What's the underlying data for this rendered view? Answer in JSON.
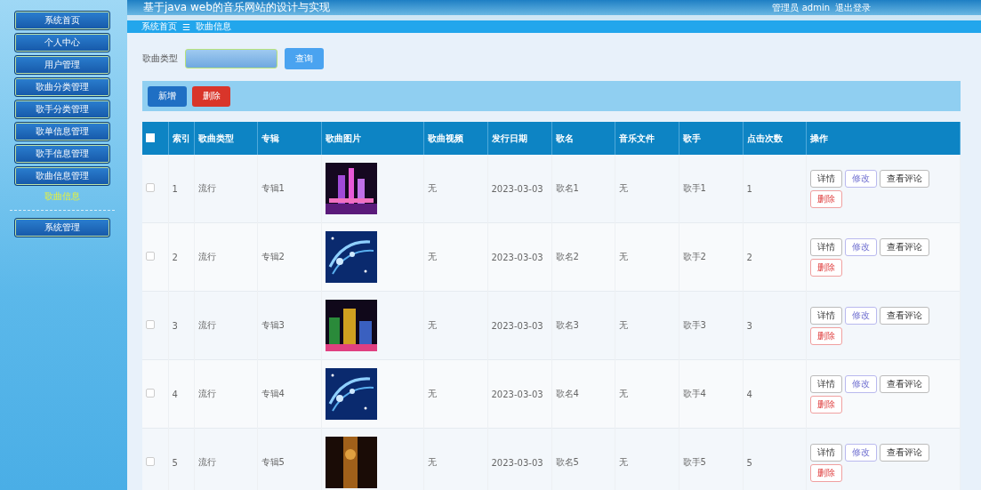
{
  "header": {
    "title": "基于java web的音乐网站的设计与实现",
    "user": "管理员 admin",
    "logout": "退出登录"
  },
  "sidebar": {
    "groups": [
      {
        "items": [
          {
            "label": "系统首页"
          },
          {
            "label": "个人中心"
          },
          {
            "label": "用户管理"
          },
          {
            "label": "歌曲分类管理"
          },
          {
            "label": "歌手分类管理"
          },
          {
            "label": "歌单信息管理"
          },
          {
            "label": "歌手信息管理"
          },
          {
            "label": "歌曲信息管理",
            "children": [
              {
                "label": "歌曲信息",
                "selected": true
              }
            ]
          }
        ]
      },
      {
        "items": [
          {
            "label": "系统管理"
          }
        ]
      }
    ]
  },
  "breadcrumb": {
    "items": [
      "系统首页",
      "歌曲信息"
    ],
    "separator": "☰"
  },
  "search": {
    "label": "歌曲类型",
    "button": "查询"
  },
  "actions": [
    {
      "label": "新增",
      "kind": "primary"
    },
    {
      "label": "删除",
      "kind": "danger"
    }
  ],
  "table": {
    "select_all": {
      "checked": false
    },
    "columns": [
      "索引",
      "歌曲类型",
      "专辑",
      "歌曲图片",
      "歌曲视频",
      "发行日期",
      "歌名",
      "音乐文件",
      "歌手",
      "点击次数",
      "操作"
    ],
    "rows": [
      {
        "checked": false,
        "cells": [
          "1",
          "流行",
          "专辑1",
          {
            "kind": "picture"
          },
          "无",
          "2023-03-03",
          "歌名1",
          "无",
          "歌手1",
          "1"
        ],
        "actions": [
          {
            "label": "详情",
            "kind": "plain"
          },
          {
            "label": "修改",
            "kind": "edit"
          },
          {
            "label": "查看评论",
            "kind": "plain"
          },
          {
            "label": "删除",
            "kind": "danger"
          }
        ]
      },
      {
        "checked": false,
        "cells": [
          "2",
          "流行",
          "专辑2",
          {
            "kind": "picture"
          },
          "无",
          "2023-03-03",
          "歌名2",
          "无",
          "歌手2",
          "2"
        ],
        "actions": [
          {
            "label": "详情",
            "kind": "plain"
          },
          {
            "label": "修改",
            "kind": "edit"
          },
          {
            "label": "查看评论",
            "kind": "plain"
          },
          {
            "label": "删除",
            "kind": "danger"
          }
        ]
      },
      {
        "checked": false,
        "cells": [
          "3",
          "流行",
          "专辑3",
          {
            "kind": "picture"
          },
          "无",
          "2023-03-03",
          "歌名3",
          "无",
          "歌手3",
          "3"
        ],
        "actions": [
          {
            "label": "详情",
            "kind": "plain"
          },
          {
            "label": "修改",
            "kind": "edit"
          },
          {
            "label": "查看评论",
            "kind": "plain"
          },
          {
            "label": "删除",
            "kind": "danger"
          }
        ]
      },
      {
        "checked": false,
        "cells": [
          "4",
          "流行",
          "专辑4",
          {
            "kind": "picture"
          },
          "无",
          "2023-03-03",
          "歌名4",
          "无",
          "歌手4",
          "4"
        ],
        "actions": [
          {
            "label": "详情",
            "kind": "plain"
          },
          {
            "label": "修改",
            "kind": "edit"
          },
          {
            "label": "查看评论",
            "kind": "plain"
          },
          {
            "label": "删除",
            "kind": "danger"
          }
        ]
      },
      {
        "checked": false,
        "cells": [
          "5",
          "流行",
          "专辑5",
          {
            "kind": "picture"
          },
          "无",
          "2023-03-03",
          "歌名5",
          "无",
          "歌手5",
          "5"
        ],
        "actions": [
          {
            "label": "详情",
            "kind": "plain"
          },
          {
            "label": "修改",
            "kind": "edit"
          },
          {
            "label": "查看评论",
            "kind": "plain"
          },
          {
            "label": "删除",
            "kind": "danger"
          }
        ]
      }
    ]
  }
}
